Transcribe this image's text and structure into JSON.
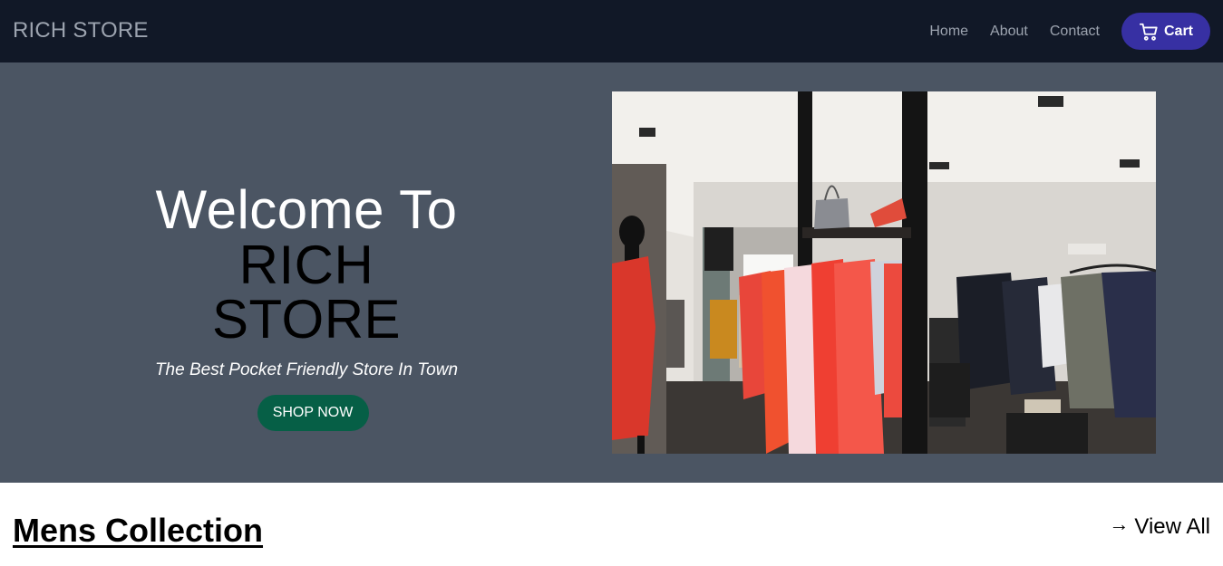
{
  "nav": {
    "brand": "RICH STORE",
    "links": [
      "Home",
      "About",
      "Contact"
    ],
    "cart_label": "Cart"
  },
  "hero": {
    "heading_line1": "Welcome To",
    "heading_line2": "RICH STORE",
    "tagline": "The Best Pocket Friendly Store In Town",
    "cta_label": "SHOP NOW"
  },
  "collection": {
    "title": "Mens Collection",
    "view_all_label": "View All"
  },
  "colors": {
    "navbar_bg": "#111827",
    "hero_bg": "#4b5563",
    "cart_button": "#3730a3",
    "shop_button": "#065f46"
  },
  "icons": {
    "cart": "shopping-cart-icon",
    "view_all": "arrow-right-icon"
  }
}
